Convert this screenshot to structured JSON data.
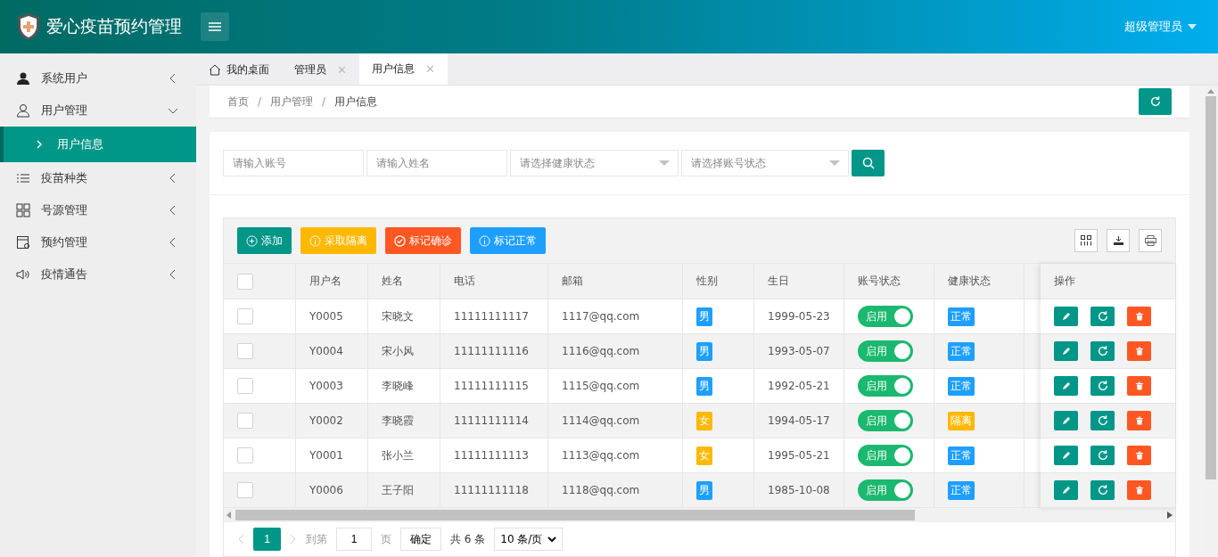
{
  "app": {
    "title": "爱心疫苗预约管理",
    "user": "超级管理员"
  },
  "sidebar": {
    "items": [
      {
        "label": "系统用户",
        "expanded": false
      },
      {
        "label": "用户管理",
        "expanded": true,
        "children": [
          {
            "label": "用户信息",
            "selected": true
          }
        ]
      },
      {
        "label": "疫苗种类",
        "expanded": false
      },
      {
        "label": "号源管理",
        "expanded": false
      },
      {
        "label": "预约管理",
        "expanded": false
      },
      {
        "label": "疫情通告",
        "expanded": false
      }
    ]
  },
  "tabs": [
    {
      "kind": "home",
      "label": "我的桌面",
      "selected": false
    },
    {
      "kind": "closable",
      "label": "管理员",
      "close": "✕",
      "selected": false
    },
    {
      "kind": "closable",
      "label": "用户信息",
      "close": "✕",
      "selected": true
    }
  ],
  "breadcrumb": {
    "separator": "/",
    "items": [
      "首页",
      "用户管理",
      "用户信息"
    ]
  },
  "filters": [
    {
      "kind": "input",
      "placeholder": "请输入账号"
    },
    {
      "kind": "input",
      "placeholder": "请输入姓名"
    },
    {
      "kind": "select",
      "placeholder": "请选择健康状态"
    },
    {
      "kind": "select",
      "placeholder": "请选择账号状态"
    }
  ],
  "actions": [
    {
      "kind": "add",
      "label": "添加",
      "color": "#009688"
    },
    {
      "kind": "isolate",
      "label": "采取隔离",
      "color": "#ffb800"
    },
    {
      "kind": "confirm",
      "label": "标记确诊",
      "color": "#ff5722"
    },
    {
      "kind": "normal",
      "label": "标记正常",
      "color": "#1e9fff"
    }
  ],
  "table": {
    "all_checked": false,
    "columns": [
      "用户名",
      "姓名",
      "电话",
      "邮箱",
      "性别",
      "生日",
      "账号状态",
      "健康状态"
    ],
    "action_column": "操作",
    "rows": [
      {
        "checked": false,
        "username": "Y0005",
        "name": "宋晓文",
        "phone": "11111111117",
        "email": "1117@qq.com",
        "gender": {
          "label": "男",
          "color": "#1e9fff"
        },
        "birthday": "1999-05-23",
        "account": "启用",
        "on": true,
        "health": {
          "label": "正常",
          "color": "#1e9fff"
        }
      },
      {
        "checked": false,
        "username": "Y0004",
        "name": "宋小风",
        "phone": "11111111116",
        "email": "1116@qq.com",
        "gender": {
          "label": "男",
          "color": "#1e9fff"
        },
        "birthday": "1993-05-07",
        "account": "启用",
        "on": true,
        "health": {
          "label": "正常",
          "color": "#1e9fff"
        }
      },
      {
        "checked": false,
        "username": "Y0003",
        "name": "李晓峰",
        "phone": "11111111115",
        "email": "1115@qq.com",
        "gender": {
          "label": "男",
          "color": "#1e9fff"
        },
        "birthday": "1992-05-21",
        "account": "启用",
        "on": true,
        "health": {
          "label": "正常",
          "color": "#1e9fff"
        }
      },
      {
        "checked": false,
        "username": "Y0002",
        "name": "李晓霞",
        "phone": "11111111114",
        "email": "1114@qq.com",
        "gender": {
          "label": "女",
          "color": "#ffb800"
        },
        "birthday": "1994-05-17",
        "account": "启用",
        "on": true,
        "health": {
          "label": "隔离",
          "color": "#ffb800"
        }
      },
      {
        "checked": false,
        "username": "Y0001",
        "name": "张小兰",
        "phone": "11111111113",
        "email": "1113@qq.com",
        "gender": {
          "label": "女",
          "color": "#ffb800"
        },
        "birthday": "1995-05-21",
        "account": "启用",
        "on": true,
        "health": {
          "label": "正常",
          "color": "#1e9fff"
        }
      },
      {
        "checked": false,
        "username": "Y0006",
        "name": "王子阳",
        "phone": "11111111118",
        "email": "1118@qq.com",
        "gender": {
          "label": "男",
          "color": "#1e9fff"
        },
        "birthday": "1985-10-08",
        "account": "启用",
        "on": true,
        "health": {
          "label": "正常",
          "color": "#1e9fff"
        }
      }
    ]
  },
  "pager": {
    "page": "1",
    "goto_label": "到第",
    "goto_value": "1",
    "page_label": "页",
    "confirm": "确定",
    "total": "共 6 条",
    "size": "10 条/页"
  }
}
